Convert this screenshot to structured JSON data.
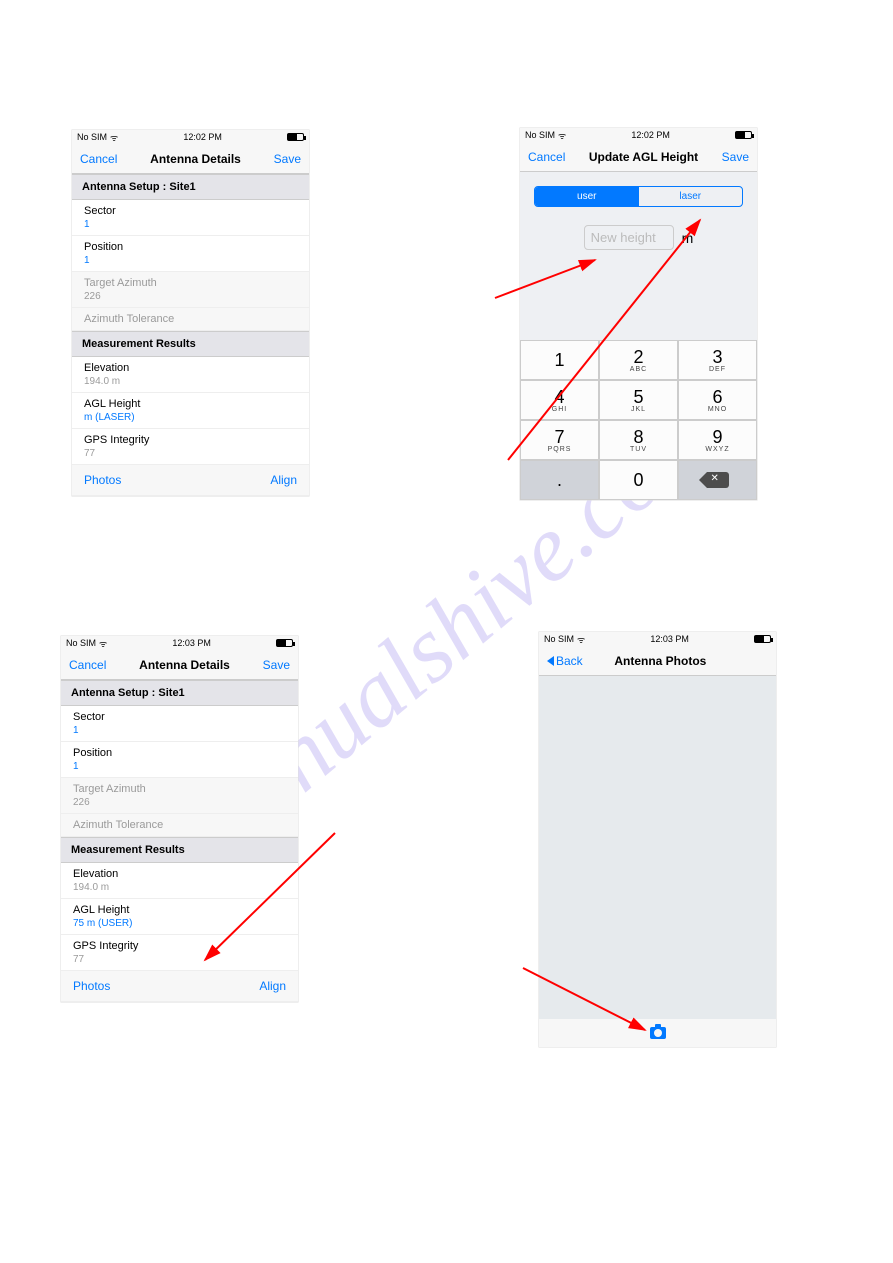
{
  "watermark": "manualshive.com",
  "screen1": {
    "status": {
      "carrier": "No SIM",
      "time": "12:02 PM"
    },
    "nav": {
      "left": "Cancel",
      "title": "Antenna Details",
      "right": "Save"
    },
    "sectionA": "Antenna Setup : Site1",
    "rows": {
      "sector": {
        "l": "Sector",
        "v": "1"
      },
      "position": {
        "l": "Position",
        "v": "1"
      },
      "azimuth": {
        "l": "Target Azimuth",
        "v": "226"
      },
      "tol": {
        "l": "Azimuth Tolerance"
      }
    },
    "sectionB": "Measurement Results",
    "rowsB": {
      "elev": {
        "l": "Elevation",
        "v": "194.0 m"
      },
      "agl": {
        "l": "AGL Height",
        "v": "m  (LASER)"
      },
      "gps": {
        "l": "GPS Integrity",
        "v": "77"
      }
    },
    "footer": {
      "photos": "Photos",
      "align": "Align"
    }
  },
  "screen2": {
    "status": {
      "carrier": "No SIM",
      "time": "12:02 PM"
    },
    "nav": {
      "left": "Cancel",
      "title": "Update AGL Height",
      "right": "Save"
    },
    "seg": {
      "user": "user",
      "laser": "laser"
    },
    "placeholder": "New height",
    "unit": "m",
    "keys": [
      {
        "n": "1",
        "l": ""
      },
      {
        "n": "2",
        "l": "ABC"
      },
      {
        "n": "3",
        "l": "DEF"
      },
      {
        "n": "4",
        "l": "GHI"
      },
      {
        "n": "5",
        "l": "JKL"
      },
      {
        "n": "6",
        "l": "MNO"
      },
      {
        "n": "7",
        "l": "PQRS"
      },
      {
        "n": "8",
        "l": "TUV"
      },
      {
        "n": "9",
        "l": "WXYZ"
      },
      {
        "n": ".",
        "l": ""
      },
      {
        "n": "0",
        "l": ""
      }
    ]
  },
  "screen3": {
    "status": {
      "carrier": "No SIM",
      "time": "12:03 PM"
    },
    "nav": {
      "left": "Cancel",
      "title": "Antenna Details",
      "right": "Save"
    },
    "sectionA": "Antenna Setup : Site1",
    "rows": {
      "sector": {
        "l": "Sector",
        "v": "1"
      },
      "position": {
        "l": "Position",
        "v": "1"
      },
      "azimuth": {
        "l": "Target Azimuth",
        "v": "226"
      },
      "tol": {
        "l": "Azimuth Tolerance"
      }
    },
    "sectionB": "Measurement Results",
    "rowsB": {
      "elev": {
        "l": "Elevation",
        "v": "194.0 m"
      },
      "agl": {
        "l": "AGL Height",
        "v": "75 m  (USER)"
      },
      "gps": {
        "l": "GPS Integrity",
        "v": "77"
      }
    },
    "footer": {
      "photos": "Photos",
      "align": "Align"
    }
  },
  "screen4": {
    "status": {
      "carrier": "No SIM",
      "time": "12:03 PM"
    },
    "nav": {
      "back": "Back",
      "title": "Antenna Photos"
    }
  }
}
